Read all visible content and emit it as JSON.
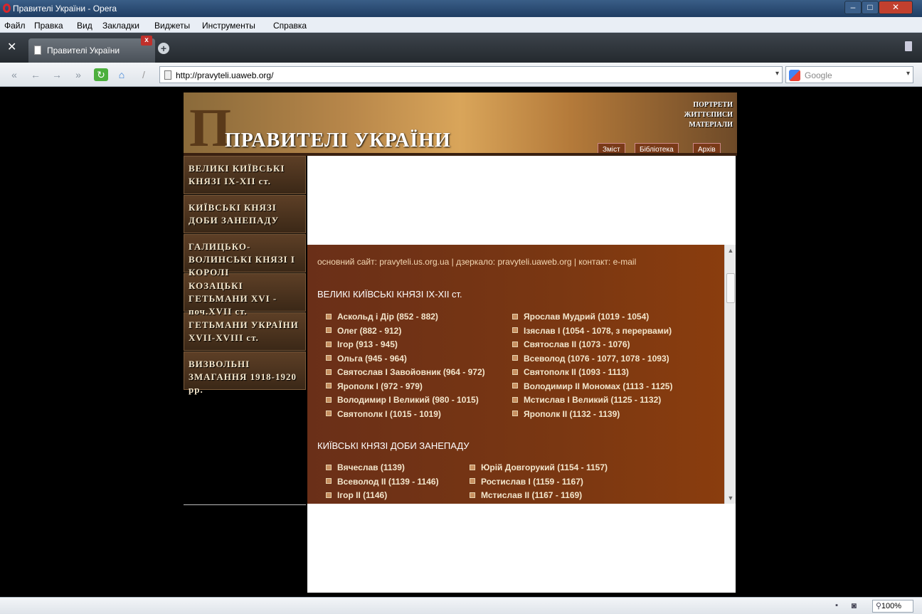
{
  "window": {
    "title": "Правителі України - Opera"
  },
  "menu": [
    "Файл",
    "Правка",
    "Вид",
    "Закладки",
    "Виджеты",
    "Инструменты",
    "Справка"
  ],
  "tab": {
    "label": "Правителі України"
  },
  "address": {
    "url": "http://pravyteli.uaweb.org/"
  },
  "search": {
    "placeholder": "Google"
  },
  "banner": {
    "title": "ПРАВИТЕЛІ УКРАЇНИ",
    "tagline": [
      "ПОРТРЕТИ",
      "ЖИТТЄПИСИ",
      "МАТЕРІАЛИ"
    ],
    "tabs": [
      "Зміст",
      "Бібліотека",
      "Архів"
    ]
  },
  "leftmenu": [
    "ВЕЛИКІ КИЇВСЬКІ КНЯЗІ IX-XII ст.",
    "КИЇВСЬКІ КНЯЗІ ДОБИ ЗАНЕПАДУ",
    "ГАЛИЦЬКО-ВОЛИНСЬКІ КНЯЗІ І КОРОЛІ",
    "КОЗАЦЬКІ ГЕТЬМАНИ XVI - поч.XVII ст.",
    "ГЕТЬМАНИ УКРАЇНИ XVII-XVIII ст.",
    "ВИЗВОЛЬНІ ЗМАГАННЯ 1918-1920 рр."
  ],
  "main": {
    "links_line": "основний сайт: pravyteli.us.org.ua  |  дзеркало: pravyteli.uaweb.org  |  контакт: e-mail",
    "section1": {
      "heading": "ВЕЛИКІ КИЇВСЬКІ КНЯЗІ IX-XII ст.",
      "col1": [
        "Аскольд і Дір   (852 - 882)",
        "Олег   (882 - 912)",
        "Ігор   (913 - 945)",
        "Ольга   (945 - 964)",
        "Святослав І Завойовник   (964 - 972)",
        "Ярополк І   (972 - 979)",
        "Володимир І Великий   (980 - 1015)",
        "Святополк І   (1015 - 1019)"
      ],
      "col2": [
        "Ярослав Мудрий   (1019 - 1054)",
        "Ізяслав І   (1054 - 1078, з перервами)",
        "Святослав ІІ   (1073 - 1076)",
        "Всеволод   (1076 - 1077, 1078 - 1093)",
        "Святополк ІІ   (1093 - 1113)",
        "Володимир ІІ Мономах   (1113 - 1125)",
        "Мстислав І Великий   (1125 - 1132)",
        "Ярополк ІІ   (1132 - 1139)"
      ]
    },
    "section2": {
      "heading": "КИЇВСЬКІ КНЯЗІ ДОБИ ЗАНЕПАДУ",
      "col1": [
        "Вячеслав   (1139)",
        "Всеволод ІІ   (1139 - 1146)",
        "Ігор ІІ   (1146)"
      ],
      "col2": [
        "Юрій Довгорукий   (1154 - 1157)",
        "Ростислав І   (1159 - 1167)",
        "Мстислав ІІ   (1167 - 1169)"
      ]
    }
  },
  "status": {
    "zoom": "100%"
  }
}
